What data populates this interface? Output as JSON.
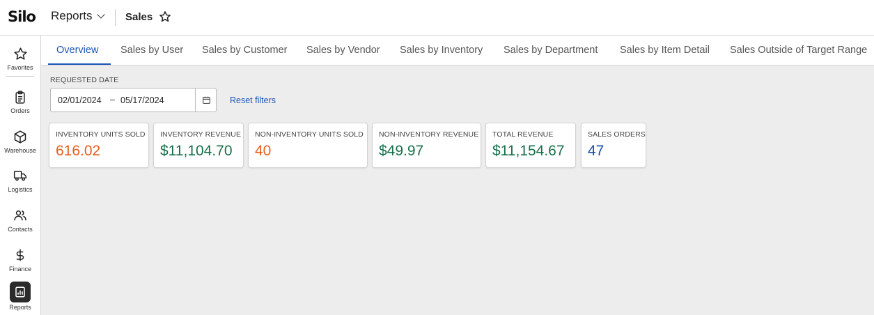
{
  "app": {
    "logo": "Silo",
    "module": "Reports",
    "page_title": "Sales"
  },
  "sidebar": {
    "items": [
      {
        "label": "Favorites",
        "icon": "star-icon"
      },
      {
        "label": "Orders",
        "icon": "clipboard-icon"
      },
      {
        "label": "Warehouse",
        "icon": "box-icon"
      },
      {
        "label": "Logistics",
        "icon": "truck-icon"
      },
      {
        "label": "Contacts",
        "icon": "users-icon"
      },
      {
        "label": "Finance",
        "icon": "dollar-icon"
      },
      {
        "label": "Reports",
        "icon": "report-icon",
        "active": true
      }
    ]
  },
  "tabs": [
    {
      "label": "Overview",
      "active": true
    },
    {
      "label": "Sales by User"
    },
    {
      "label": "Sales by Customer"
    },
    {
      "label": "Sales by Vendor"
    },
    {
      "label": "Sales by Inventory"
    },
    {
      "label": "Sales by Department"
    },
    {
      "label": "Sales by Item Detail"
    },
    {
      "label": "Sales Outside of Target Range"
    }
  ],
  "filters": {
    "date_label": "REQUESTED DATE",
    "date_from": "02/01/2024",
    "date_sep": "–",
    "date_to": "05/17/2024",
    "reset_label": "Reset filters"
  },
  "kpis": [
    {
      "label": "INVENTORY UNITS SOLD",
      "value": "616.02",
      "color": "#e85d1e"
    },
    {
      "label": "INVENTORY REVENUE",
      "value": "$11,104.70",
      "color": "#17704a"
    },
    {
      "label": "NON-INVENTORY UNITS SOLD",
      "value": "40",
      "color": "#e85d1e"
    },
    {
      "label": "NON-INVENTORY REVENUE",
      "value": "$49.97",
      "color": "#17704a"
    },
    {
      "label": "TOTAL REVENUE",
      "value": "$11,154.67",
      "color": "#17704a"
    },
    {
      "label": "SALES ORDERS",
      "value": "47",
      "color": "#1a4fa8"
    }
  ],
  "colors": {
    "accent": "#1a54b8",
    "background": "#ededed"
  }
}
